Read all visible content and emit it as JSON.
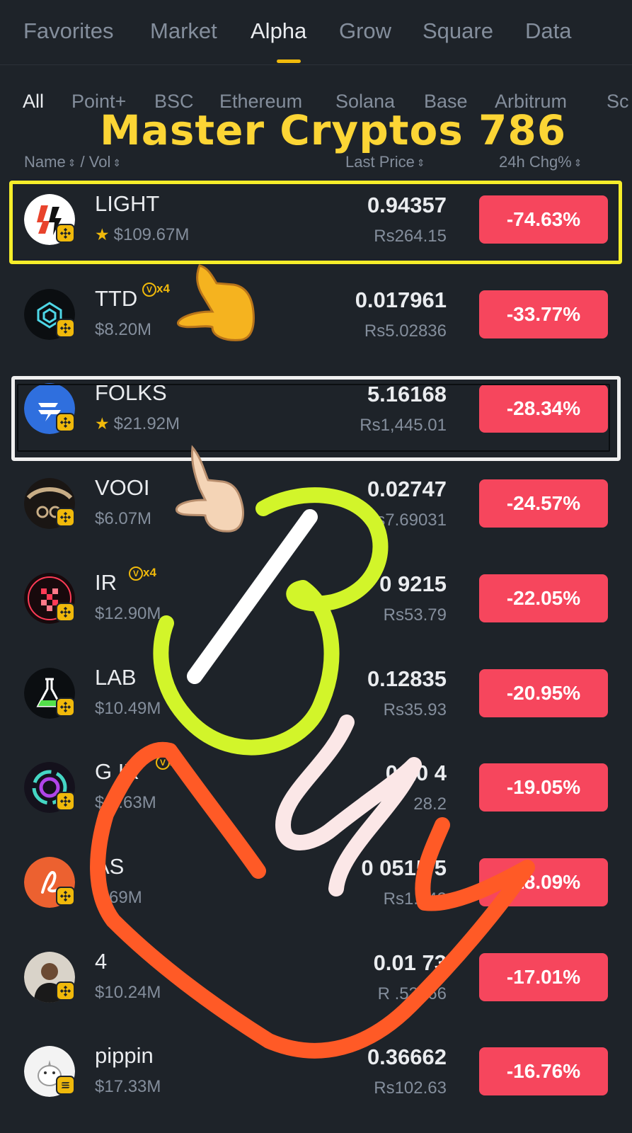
{
  "top_tabs": [
    "Favorites",
    "Market",
    "Alpha",
    "Grow",
    "Square",
    "Data"
  ],
  "chains": [
    "All",
    "Point+",
    "BSC",
    "Ethereum",
    "Solana",
    "Base",
    "Arbitrum",
    "Sc"
  ],
  "watermark": "Master Cryptos 786",
  "columns": {
    "name": "Name",
    "sep": " / ",
    "vol": "Vol",
    "price": "Last Price",
    "change": "24h Chg%"
  },
  "colors": {
    "accent": "#f0b90b",
    "down": "#f6465d",
    "background": "#1e2329",
    "muted": "#848e9c"
  },
  "rows": [
    {
      "symbol": "LIGHT",
      "favorite": true,
      "volume": "$109.67M",
      "price": "0.94357",
      "fiat": "Rs264.15",
      "change": "-74.63%",
      "multiplier": "",
      "logo": "light-logo",
      "chain": "bnb-icon"
    },
    {
      "symbol": "TTD",
      "favorite": false,
      "volume": "$8.20M",
      "price": "0.017961",
      "fiat": "Rs5.02836",
      "change": "-33.77%",
      "multiplier": "x4",
      "logo": "ttd-logo",
      "chain": "bnb-icon"
    },
    {
      "symbol": "FOLKS",
      "favorite": true,
      "volume": "$21.92M",
      "price": "5.16168",
      "fiat": "Rs1,445.01",
      "change": "-28.34%",
      "multiplier": "",
      "logo": "folks-logo",
      "chain": "bnb-icon"
    },
    {
      "symbol": "VOOI",
      "favorite": false,
      "volume": "$6.07M",
      "price": "0.02747",
      "fiat": "s7.69031",
      "change": "-24.57%",
      "multiplier": "",
      "logo": "vooi-logo",
      "chain": "bnb-icon"
    },
    {
      "symbol": "IR",
      "favorite": false,
      "volume": "$12.90M",
      "price": "0 9215",
      "fiat": "Rs53.79",
      "change": "-22.05%",
      "multiplier": "x4",
      "logo": "ir-logo",
      "chain": "bnb-icon"
    },
    {
      "symbol": "LAB",
      "favorite": false,
      "volume": "$10.49M",
      "price": "0.12835",
      "fiat": "Rs35.93",
      "change": "-20.95%",
      "multiplier": "",
      "logo": "lab-logo",
      "chain": "bnb-icon"
    },
    {
      "symbol": "G IX",
      "favorite": false,
      "volume": "$ 5.63M",
      "price": "0.10 4",
      "fiat": "28.2",
      "change": "-19.05%",
      "multiplier": "x4",
      "logo": "gaix-logo",
      "chain": "bnb-icon"
    },
    {
      "symbol": "AS",
      "favorite": false,
      "volume": "$ 69M",
      "price": "0 0515 5",
      "fiat": "Rs1.442",
      "change": "-18.09%",
      "multiplier": "",
      "logo": "as-logo",
      "chain": "bnb-icon"
    },
    {
      "symbol": "4",
      "favorite": false,
      "volume": "$10.24M",
      "price": "0.01 73",
      "fiat": "R .53566",
      "change": "-17.01%",
      "multiplier": "",
      "logo": "four-logo",
      "chain": "bnb-icon"
    },
    {
      "symbol": "pippin",
      "favorite": false,
      "volume": "$17.33M",
      "price": "0.36662",
      "fiat": "Rs102.63",
      "change": "-16.76%",
      "multiplier": "",
      "logo": "pippin-logo",
      "chain": "solana-icon"
    }
  ]
}
